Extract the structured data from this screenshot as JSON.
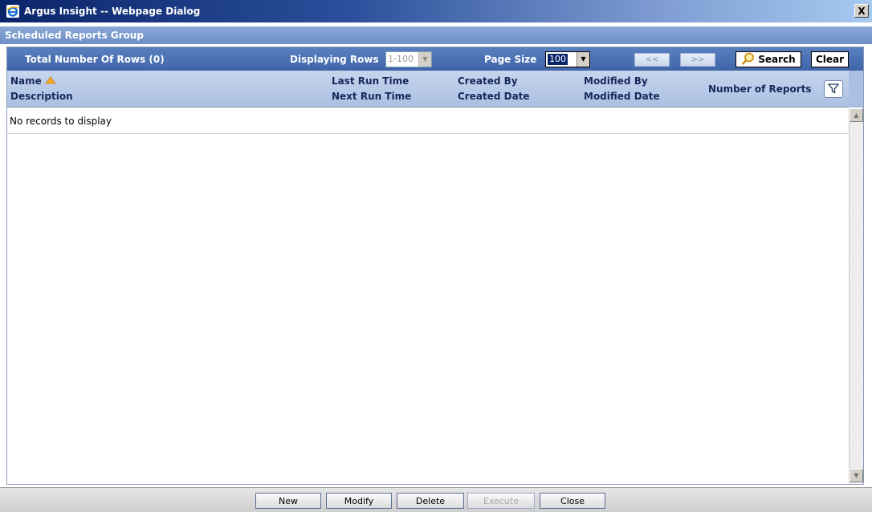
{
  "window": {
    "title": "Argus Insight -- Webpage Dialog",
    "close_glyph": "X"
  },
  "section": {
    "title": "Scheduled Reports Group"
  },
  "toolbar": {
    "total_rows_label": "Total Number Of Rows (0)",
    "displaying_rows_label": "Displaying Rows",
    "displaying_rows_value": "1-100",
    "page_size_label": "Page Size",
    "page_size_value": "100",
    "prev_label": "<<",
    "next_label": ">>",
    "search_label": "Search",
    "clear_label": "Clear"
  },
  "columns": {
    "name": "Name",
    "description": "Description",
    "last_run_time": "Last Run Time",
    "next_run_time": "Next Run Time",
    "created_by": "Created By",
    "created_date": "Created Date",
    "modified_by": "Modified By",
    "modified_date": "Modified Date",
    "number_of_reports": "Number of Reports",
    "sort_icon": "sort-ascending-icon",
    "filter_icon": "filter-icon"
  },
  "grid": {
    "empty_message": "No records to display"
  },
  "footer": {
    "new_label": "New",
    "modify_label": "Modify",
    "delete_label": "Delete",
    "execute_label": "Execute",
    "close_label": "Close"
  },
  "colors": {
    "accent": "#3f64a8",
    "header": "#aabfe2",
    "sort_icon": "#f5a623"
  }
}
